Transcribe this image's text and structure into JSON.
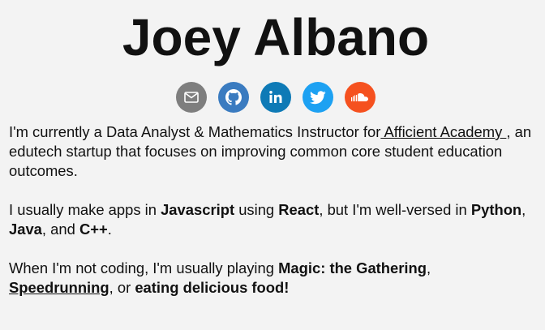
{
  "header": {
    "name": "Joey Albano"
  },
  "socials": [
    {
      "name": "email",
      "icon": "mail-icon",
      "color": "#7e7e7e"
    },
    {
      "name": "github",
      "icon": "github-icon",
      "color": "#3a7bc0"
    },
    {
      "name": "linkedin",
      "icon": "linkedin-icon",
      "color": "#0e7ab6"
    },
    {
      "name": "twitter",
      "icon": "twitter-icon",
      "color": "#1da1f2"
    },
    {
      "name": "soundcloud",
      "icon": "soundcloud-icon",
      "color": "#f5511f"
    }
  ],
  "bio": {
    "p1": {
      "text1": "I'm currently a Data Analyst & Mathematics Instructor for",
      "link": " Afficient Academy ",
      "text2": ", an",
      "line2": "edutech startup that focuses on improving common core student education",
      "line3": "outcomes."
    },
    "p2": {
      "text1": "I usually make apps in ",
      "lang1": "Javascript",
      "text2": " using ",
      "lang2": "React",
      "text3": ", but I'm well-versed in ",
      "lang3": "Python",
      "text4": ",",
      "lang4": "Java",
      "text5": ", and ",
      "lang5": "C++",
      "text6": "."
    },
    "p3": {
      "text1": "When I'm not coding, I'm usually playing ",
      "hobby1": "Magic: the Gathering",
      "text2": ",",
      "hobby2": "Speedrunning",
      "text3": ", or ",
      "hobby3": "eating delicious food!"
    }
  }
}
